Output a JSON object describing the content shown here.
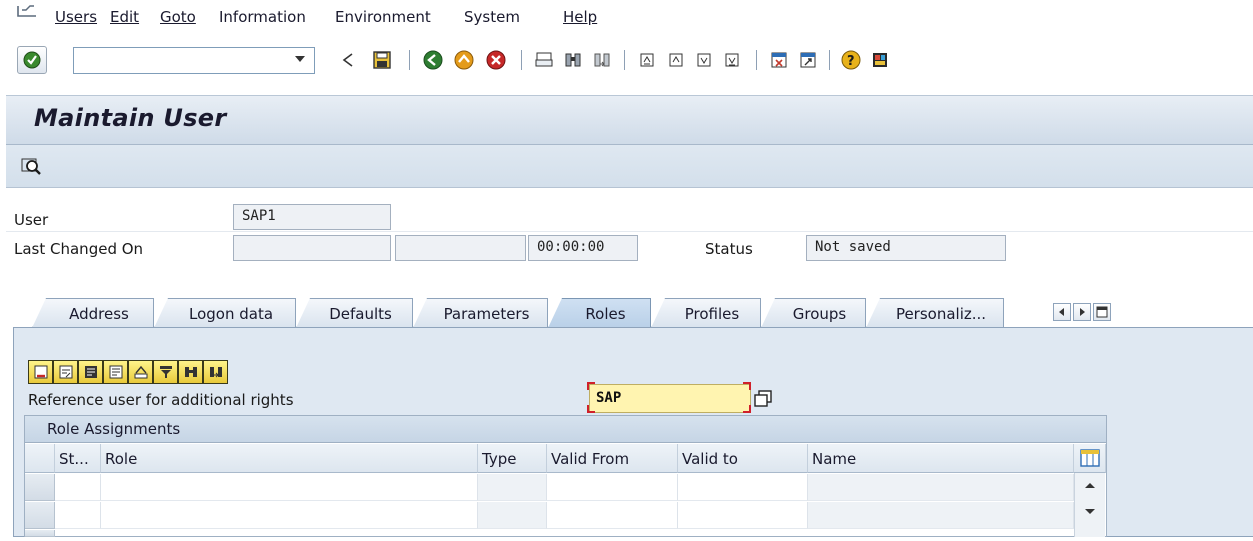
{
  "menu": {
    "items": [
      {
        "label": "Users",
        "mnemonic": "U"
      },
      {
        "label": "Edit",
        "mnemonic": "E"
      },
      {
        "label": "Goto",
        "mnemonic": "G"
      },
      {
        "label": "Information",
        "mnemonic": "f"
      },
      {
        "label": "Environment",
        "mnemonic": "v"
      },
      {
        "label": "System",
        "mnemonic": "y"
      },
      {
        "label": "Help",
        "mnemonic": "H"
      }
    ]
  },
  "toolbar": {
    "command_value": "",
    "icons": [
      "enter-icon",
      "back-arrow-icon",
      "save-icon",
      "back-icon",
      "exit-icon",
      "cancel-icon",
      "print-icon",
      "find-icon",
      "find-next-icon",
      "first-page-icon",
      "previous-page-icon",
      "next-page-icon",
      "last-page-icon",
      "new-session-icon",
      "shortcut-icon",
      "help-icon",
      "layout-icon"
    ]
  },
  "title": "Maintain User",
  "header": {
    "user_label": "User",
    "user_value": "SAP1",
    "last_changed_label": "Last Changed On",
    "last_changed_by": "",
    "last_changed_date": "",
    "last_changed_time": "00:00:00",
    "status_label": "Status",
    "status_value": "Not saved"
  },
  "tabs": [
    {
      "label": "Address",
      "active": false
    },
    {
      "label": "Logon data",
      "active": false
    },
    {
      "label": "Defaults",
      "active": false
    },
    {
      "label": "Parameters",
      "active": false
    },
    {
      "label": "Roles",
      "active": true
    },
    {
      "label": "Profiles",
      "active": false
    },
    {
      "label": "Groups",
      "active": false
    },
    {
      "label": "Personaliz...",
      "active": false
    }
  ],
  "roles": {
    "ref_user_label": "Reference user for additional rights",
    "ref_user_value": "SAP",
    "table_title": "Role Assignments",
    "columns": [
      "St...",
      "Role",
      "Type",
      "Valid From",
      "Valid to",
      "Name"
    ],
    "rows": [
      {
        "status": "",
        "role": "",
        "type": "",
        "valid_from": "",
        "valid_to": "",
        "name": ""
      },
      {
        "status": "",
        "role": "",
        "type": "",
        "valid_from": "",
        "valid_to": "",
        "name": ""
      }
    ]
  },
  "colors": {
    "title_bar": "#cfdbe8",
    "tab_panel": "#dfe8f2",
    "required_field": "#fff4b0",
    "table_toolbar_button": "#e8c93b"
  }
}
